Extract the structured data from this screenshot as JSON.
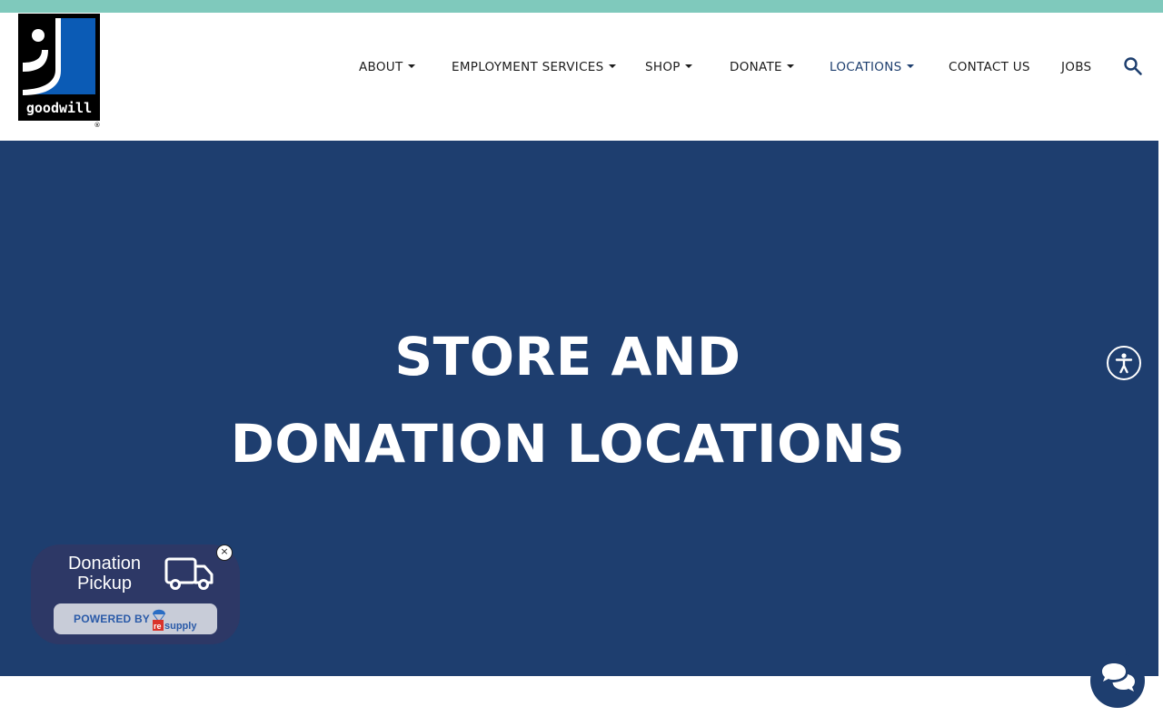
{
  "nav": {
    "items": [
      {
        "label": "ABOUT",
        "has_dropdown": true,
        "active": false
      },
      {
        "label": "EMPLOYMENT SERVICES",
        "has_dropdown": true,
        "active": false
      },
      {
        "label": "SHOP",
        "has_dropdown": true,
        "active": false
      },
      {
        "label": "DONATE",
        "has_dropdown": true,
        "active": false
      },
      {
        "label": "LOCATIONS",
        "has_dropdown": true,
        "active": true
      },
      {
        "label": "CONTACT US",
        "has_dropdown": false,
        "active": false
      },
      {
        "label": "JOBS",
        "has_dropdown": false,
        "active": false
      }
    ],
    "search_icon": "search-icon"
  },
  "logo": {
    "wordmark": "goodwill",
    "registered": "®"
  },
  "hero": {
    "title": "STORE AND DONATION LOCATIONS"
  },
  "pickup_widget": {
    "label": "Donation Pickup",
    "powered_by": "POWERED BY",
    "brand": "resupply",
    "close_label": "×"
  },
  "colors": {
    "top_strip": "#7fc9bc",
    "hero_bg": "#1e3e6f",
    "nav_active": "#1d3e6e",
    "logo_blue": "#0b5bb5"
  },
  "icons": [
    "search-icon",
    "accessibility-icon",
    "truck-icon",
    "chat-icon",
    "close-icon",
    "parachute-icon"
  ]
}
